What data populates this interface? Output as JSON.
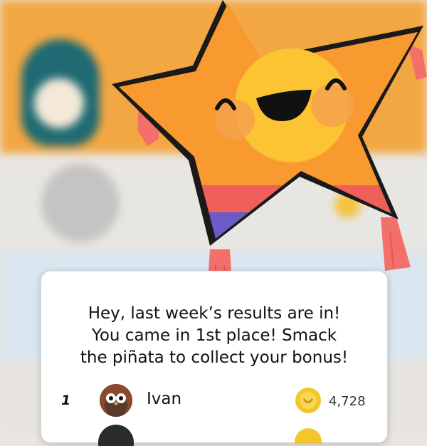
{
  "colors": {
    "header_orange": "#f2a742",
    "star_orange": "#f99a30",
    "star_face": "#fcc332",
    "stripe_red": "#f0605a",
    "stripe_purple": "#6a5bc8",
    "tassel_pink": "#f36f6a",
    "coin_gold": "#f5c52c"
  },
  "dialog": {
    "message_lines": [
      "Hey, last week’s results are in!",
      "You came in 1st place! Smack",
      "the piñata to collect your bonus!"
    ],
    "leaderboard": [
      {
        "rank": "1",
        "name": "Ivan",
        "score": "4,728",
        "avatar_icon": "owl-avatar-icon",
        "coin_icon": "coin-icon"
      }
    ]
  }
}
